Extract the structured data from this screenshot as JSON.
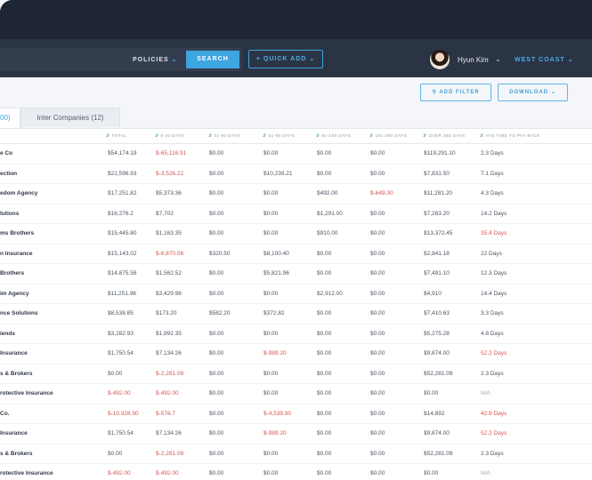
{
  "header": {
    "policies_label": "POLICIES",
    "search_label": "SEARCH",
    "quick_add_label": "+ QUICK ADD",
    "user_name": "Hyun Kim",
    "region_label": "WEST COAST"
  },
  "toolbar": {
    "add_filter_label": "ADD FILTER",
    "download_label": "DOWNLOAD"
  },
  "tabs": [
    {
      "label": "00)"
    },
    {
      "label": "Inter Companies (12)"
    }
  ],
  "columns": [
    "TOTAL",
    "0-30 DAYS",
    "31-60 DAYS",
    "61-90 DAYS",
    "91-180 DAYS",
    "181-360 DAYS",
    "OVER 360 DAYS",
    "AVG TIME TO PAY BACK"
  ],
  "rows": [
    {
      "name": "e Co",
      "total": "$54,174.19",
      "d0": "$-65,116.91",
      "d31": "$0.00",
      "d61": "$0.00",
      "d91": "$0.00",
      "d181": "$0.00",
      "over": "$119,291.10",
      "avg": "2.3 Days"
    },
    {
      "name": "ection",
      "total": "$21,596.93",
      "d0": "$-3,526.22",
      "d31": "$0.00",
      "d61": "$10,239.21",
      "d91": "$0.00",
      "d181": "$0.00",
      "over": "$7,831.50",
      "avg": "7.1 Days"
    },
    {
      "name": "edom Agency",
      "total": "$17,251.82",
      "d0": "$5,373.36",
      "d31": "$0.00",
      "d61": "$0.00",
      "d91": "$492.00",
      "d181": "$-649.30",
      "over": "$11,281.20",
      "avg": "4.3 Days"
    },
    {
      "name": "lutions",
      "total": "$16,276.2",
      "d0": "$7,702",
      "d31": "$0.00",
      "d61": "$0.00",
      "d91": "$1,291.00",
      "d181": "$0.00",
      "over": "$7,283.20",
      "avg": "14.2 Days"
    },
    {
      "name": "ms Brothers",
      "total": "$15,445.80",
      "d0": "$1,163.35",
      "d31": "$0.00",
      "d61": "$0.00",
      "d91": "$910.00",
      "d181": "$0.00",
      "over": "$13,372.45",
      "avg": "35.4 Days"
    },
    {
      "name": "n Insurance",
      "total": "$15,143.02",
      "d0": "$-6,870.06",
      "d31": "$320.50",
      "d61": "$8,100.40",
      "d91": "$0.00",
      "d181": "$0.00",
      "over": "$2,841.18",
      "avg": "22 Days"
    },
    {
      "name": "Brothers",
      "total": "$14,875.58",
      "d0": "$1,562.52",
      "d31": "$0.00",
      "d61": "$5,821.96",
      "d91": "$0.00",
      "d181": "$0.00",
      "over": "$7,491.10",
      "avg": "12.3 Days"
    },
    {
      "name": "im Agency",
      "total": "$11,251.96",
      "d0": "$3,429.96",
      "d31": "$0.00",
      "d61": "$0.00",
      "d91": "$2,912.00",
      "d181": "$0.00",
      "over": "$4,910",
      "avg": "14.4 Days"
    },
    {
      "name": "nce Solutions",
      "total": "$8,538.85",
      "d0": "$173.20",
      "d31": "$582.20",
      "d61": "$372.82",
      "d91": "$0.00",
      "d181": "$0.00",
      "over": "$7,410.63",
      "avg": "3.3 Days"
    },
    {
      "name": "iends",
      "total": "$3,282.93",
      "d0": "$1,992.35",
      "d31": "$0.00",
      "d61": "$0.00",
      "d91": "$0.00",
      "d181": "$0.00",
      "over": "$5,275.28",
      "avg": "4.8 Days"
    },
    {
      "name": "Insurance",
      "total": "$1,750.54",
      "d0": "$7,134.26",
      "d31": "$0.00",
      "d61": "$-989.20",
      "d91": "$0.00",
      "d181": "$0.00",
      "over": "$9,874.00",
      "avg": "52.2 Days"
    },
    {
      "name": "s & Brokers",
      "total": "$0.00",
      "d0": "$-2,281.09",
      "d31": "$0.00",
      "d61": "$0.00",
      "d91": "$0.00",
      "d181": "$0.00",
      "over": "$52,281.09",
      "avg": "2.3 Days"
    },
    {
      "name": "rotective Insurance",
      "total": "$-492.00",
      "d0": "$-492.00",
      "d31": "$0.00",
      "d61": "$0.00",
      "d91": "$0.00",
      "d181": "$0.00",
      "over": "$0.00",
      "avg": "N/A"
    },
    {
      "name": "Co.",
      "total": "$-10,928.90",
      "d0": "$-576.7",
      "d31": "$0.00",
      "d61": "$-4,539.90",
      "d91": "$0.00",
      "d181": "$0.00",
      "over": "$14,892",
      "avg": "42.9 Days"
    },
    {
      "name": "Insurance",
      "total": "$1,750.54",
      "d0": "$7,134.26",
      "d31": "$0.00",
      "d61": "$-989.20",
      "d91": "$0.00",
      "d181": "$0.00",
      "over": "$9,874.00",
      "avg": "52.2 Days"
    },
    {
      "name": "s & Brokers",
      "total": "$0.00",
      "d0": "$-2,281.09",
      "d31": "$0.00",
      "d61": "$0.00",
      "d91": "$0.00",
      "d181": "$0.00",
      "over": "$52,281.09",
      "avg": "2.3 Days"
    },
    {
      "name": "rotective Insurance",
      "total": "$-492.00",
      "d0": "$-492.00",
      "d31": "$0.00",
      "d61": "$0.00",
      "d91": "$0.00",
      "d181": "$0.00",
      "over": "$0.00",
      "avg": "N/A"
    }
  ],
  "colors": {
    "header_bg": "#2b3444",
    "accent": "#3da5e0",
    "negative": "#d9534f",
    "sort_icon": "#3aa86b"
  }
}
